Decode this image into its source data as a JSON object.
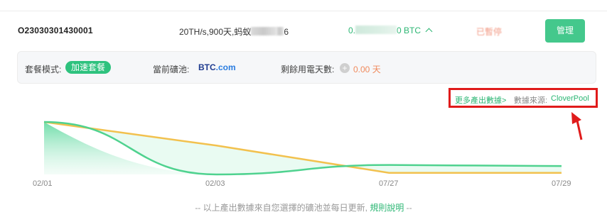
{
  "order": {
    "id": "O23030301430001",
    "package_prefix": "20TH/s,900天,蚂蚁",
    "package_suffix": "6",
    "output_prefix": "0.",
    "output_suffix": "0 BTC",
    "status": "已暫停",
    "manage_label": "管理"
  },
  "info": {
    "mode_label": "套餐模式:",
    "mode_value": "加速套餐",
    "pool_label": "當前礦池:",
    "pool_logo_a": "BTC",
    "pool_logo_b": ".com",
    "days_label": "剩餘用電天數:",
    "days_value": "0.00 天",
    "plus_icon": "+"
  },
  "source": {
    "more_link": "更多產出數據>",
    "label": "數據來源:",
    "name": "CloverPool"
  },
  "colors": {
    "accent_green": "#2bb673",
    "yellow_line": "#f2c14e",
    "highlight_red": "#e01b1b"
  },
  "chart_data": {
    "type": "line",
    "categories": [
      "02/01",
      "02/03",
      "07/27",
      "07/29"
    ],
    "series": [
      {
        "values": [
          1.0,
          0.0,
          0.18,
          0.16
        ]
      },
      {
        "values": [
          1.0,
          0.55,
          0.03,
          0.03
        ]
      }
    ],
    "ylim": [
      0,
      1
    ],
    "grid": false
  },
  "footer": {
    "prefix": "-- 以上產出數據來自您選擇的礦池並每日更新,",
    "link": "規則說明",
    "suffix": " --"
  }
}
